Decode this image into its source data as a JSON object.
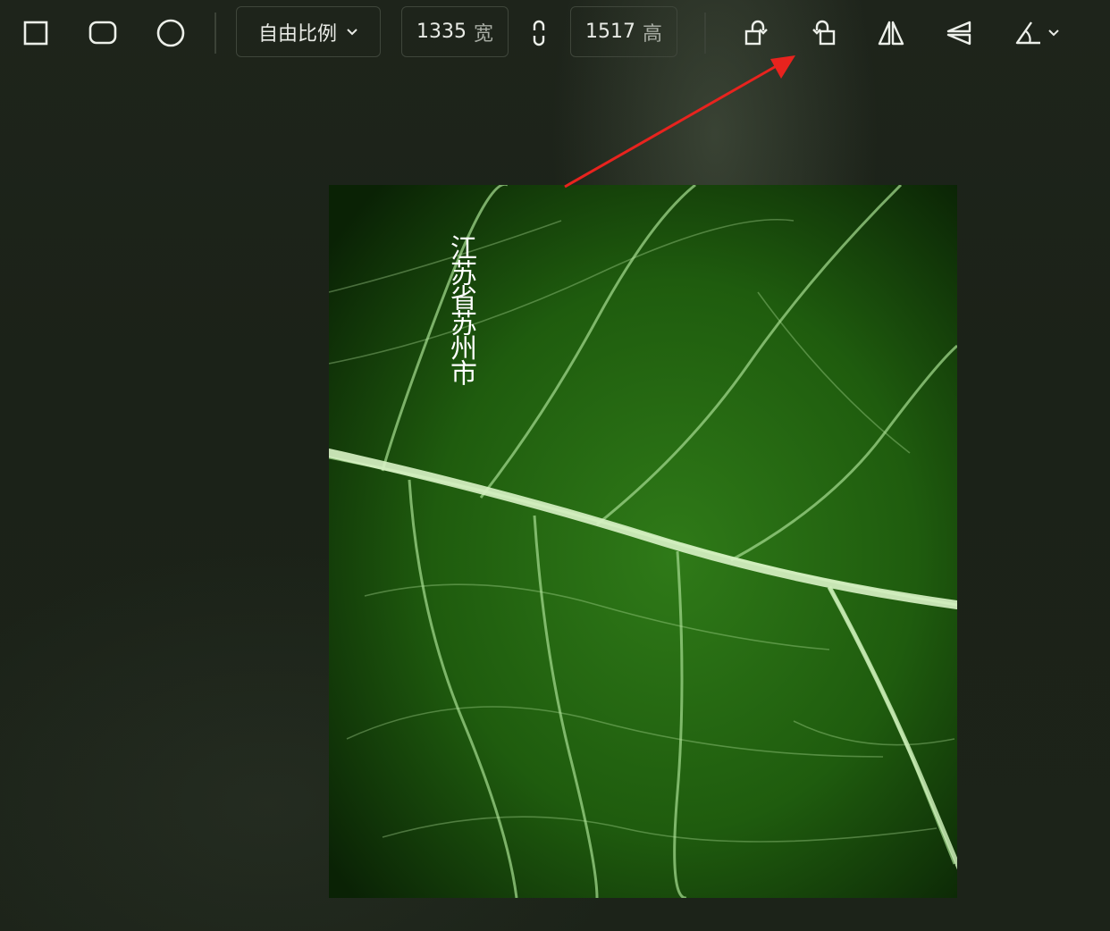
{
  "toolbar": {
    "ratio_label": "自由比例",
    "width_value": "1335",
    "width_unit": "宽",
    "height_value": "1517",
    "height_unit": "高"
  },
  "icons": {
    "shape_square": "square-icon",
    "shape_rounded": "rounded-square-icon",
    "shape_circle": "circle-icon",
    "ratio_dropdown": "chevron-down-icon",
    "aspect_lock": "link-icon",
    "rotate_left": "rotate-left-icon",
    "rotate_right": "rotate-right-icon",
    "flip_horizontal": "flip-horizontal-icon",
    "flip_vertical": "flip-vertical-icon",
    "angle": "angle-icon"
  },
  "canvas": {
    "watermark_text": "江苏省苏州市"
  },
  "annotation": {
    "arrow_color": "#e8231e"
  }
}
